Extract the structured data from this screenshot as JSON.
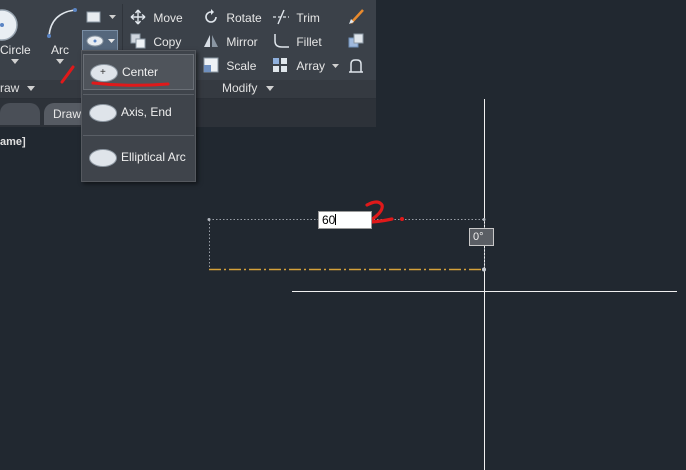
{
  "ribbon": {
    "draw_panel": {
      "title": "raw",
      "circle_label": "Circle",
      "arc_label": "Arc"
    },
    "modify_panel": {
      "title": "Modify",
      "commands": [
        {
          "label": "Move",
          "icon": "move-icon"
        },
        {
          "label": "Copy",
          "icon": "copy-icon"
        },
        {
          "label": "Rotate",
          "icon": "rotate-icon"
        },
        {
          "label": "Mirror",
          "icon": "mirror-icon"
        },
        {
          "label": "Scale",
          "icon": "scale-icon"
        },
        {
          "label": "Trim",
          "icon": "trim-icon"
        },
        {
          "label": "Fillet",
          "icon": "fillet-icon"
        },
        {
          "label": "Array",
          "icon": "array-icon"
        }
      ]
    }
  },
  "tabs": {
    "active": "Draw"
  },
  "command_line": {
    "text": "ame]"
  },
  "ellipse_menu": {
    "items": [
      {
        "label": "Center",
        "icon": "ellipse-center-icon"
      },
      {
        "label": "Axis, End",
        "icon": "ellipse-axis-end-icon"
      },
      {
        "label": "Elliptical Arc",
        "icon": "elliptical-arc-icon"
      }
    ]
  },
  "canvas": {
    "dynamic_input_value": "60",
    "angle_tooltip": "0°"
  },
  "annotations": {
    "step1": "1",
    "step2": "2"
  },
  "colors": {
    "canvas_bg": "#212830",
    "ribbon_bg": "#3b4149",
    "annotation_red": "#e0191a",
    "crosshair": "#f0f0f0",
    "dashed_line": "#d6a23a"
  }
}
